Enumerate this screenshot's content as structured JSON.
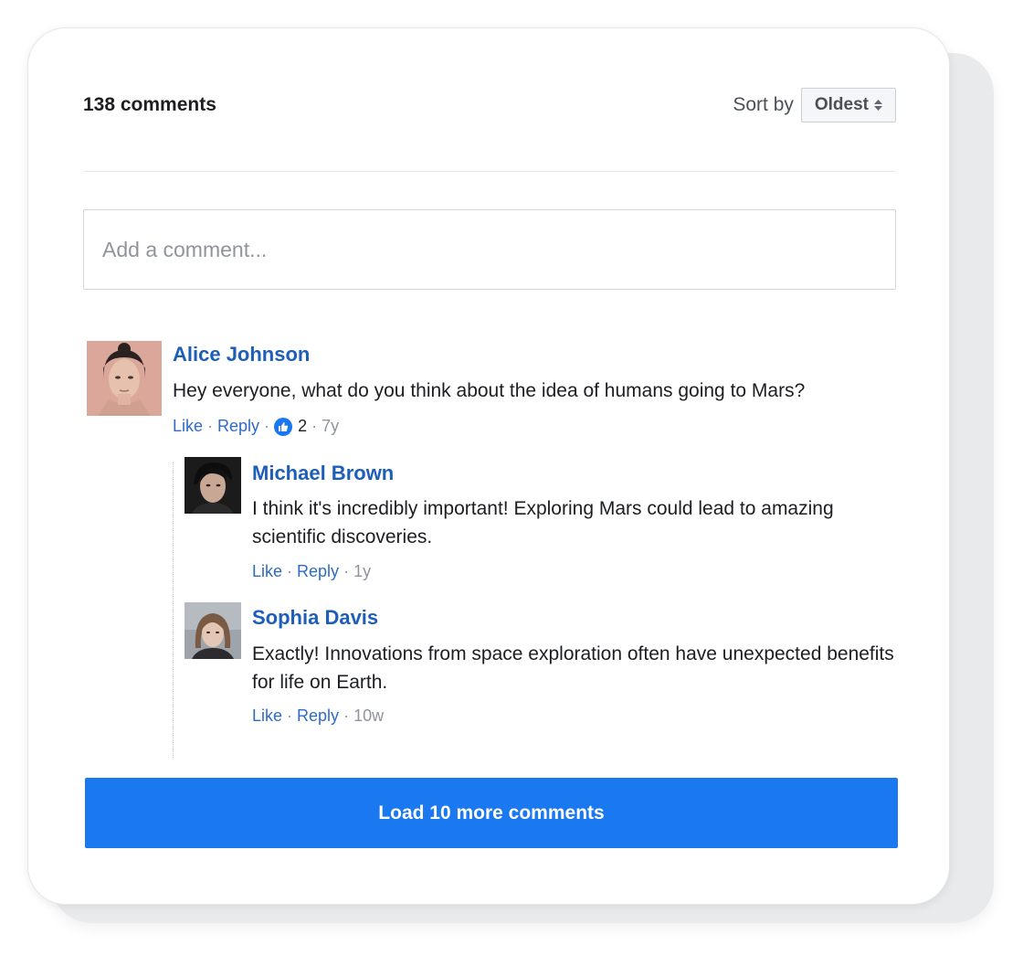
{
  "header": {
    "comment_count": "138 comments",
    "sort_label": "Sort by",
    "sort_value": "Oldest"
  },
  "composer": {
    "placeholder": "Add a comment..."
  },
  "comments": [
    {
      "author": "Alice Johnson",
      "text": "Hey everyone, what do you think about the idea of humans going to Mars?",
      "like": "Like",
      "reply": "Reply",
      "likes": "2",
      "age": "7y",
      "replies": [
        {
          "author": "Michael Brown",
          "text": "I think it's incredibly important! Exploring Mars could lead to amazing scientific discoveries.",
          "like": "Like",
          "reply": "Reply",
          "age": "1y"
        },
        {
          "author": "Sophia Davis",
          "text": "Exactly! Innovations from space exploration often have unexpected benefits for life on Earth.",
          "like": "Like",
          "reply": "Reply",
          "age": "10w"
        }
      ]
    }
  ],
  "load_more": "Load 10 more comments",
  "colors": {
    "accent": "#1a78f0",
    "link": "#2e6bc6",
    "author": "#1d5fb8"
  }
}
